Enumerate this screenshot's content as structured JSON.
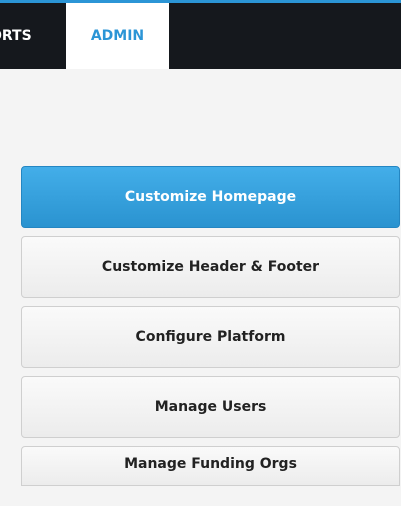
{
  "nav": {
    "tabs": [
      {
        "label": "ORTS"
      },
      {
        "label": "ADMIN"
      }
    ],
    "active_tab": "ADMIN"
  },
  "admin_menu": {
    "items": [
      {
        "label": "Customize Homepage",
        "active": true
      },
      {
        "label": "Customize Header & Footer",
        "active": false
      },
      {
        "label": "Configure Platform",
        "active": false
      },
      {
        "label": "Manage Users",
        "active": false
      },
      {
        "label": "Manage Funding Orgs",
        "active": false
      }
    ]
  },
  "colors": {
    "accent": "#2b95d6",
    "topbar": "#15181d",
    "active_button": "#3aa3e0",
    "page_background": "#f4f4f4"
  }
}
